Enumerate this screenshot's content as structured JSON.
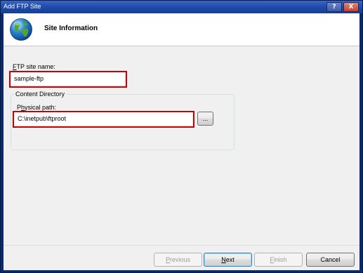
{
  "window": {
    "title": "Add FTP Site",
    "help_glyph": "?",
    "close_glyph": "X"
  },
  "header": {
    "title": "Site Information",
    "icon": "globe-icon"
  },
  "form": {
    "site_name_label_accel": "F",
    "site_name_label_rest": "TP site name:",
    "site_name_value": "sample-ftp",
    "content_directory_label": "Content Directory",
    "physical_path_label_pre": "P",
    "physical_path_label_accel": "h",
    "physical_path_label_rest": "ysical path:",
    "physical_path_value": "C:\\inetpub\\ftproot",
    "browse_label": "..."
  },
  "footer": {
    "previous_accel": "P",
    "previous_rest": "revious",
    "next_accel": "N",
    "next_rest": "ext",
    "finish_accel": "F",
    "finish_rest": "inish",
    "cancel_label": "Cancel"
  },
  "colors": {
    "highlight_box": "#cc0000",
    "titlebar": "#1c4aa6"
  }
}
